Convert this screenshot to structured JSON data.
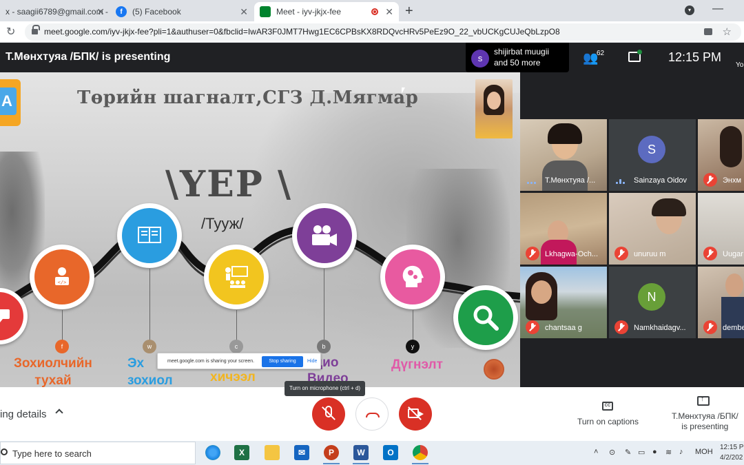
{
  "browser": {
    "tabs": [
      {
        "title": "x - saagii6789@gmail.com -",
        "favicon": "gmail-icon"
      },
      {
        "title": "(5) Facebook",
        "favicon": "facebook-icon"
      },
      {
        "title": "Meet - iyv-jkjx-fee",
        "favicon": "meet-icon",
        "active": true
      }
    ],
    "url": "meet.google.com/iyv-jkjx-fee?pli=1&authuser=0&fbclid=IwAR3F0JMT7Hwg1EC6CPBsKX8RDQvcHRv5PeEz9O_22_vbUCKgCUJeQbLzpO8"
  },
  "meet_header": {
    "presenting_title": "Т.Мөнхтуяа /БПК/ is presenting",
    "joined_avatar": "s",
    "joined_line1": "shijirbat muugii",
    "joined_line2": "and 50 more",
    "people_count": "62",
    "time": "12:15  PM",
    "you_label": "Yo"
  },
  "slide": {
    "title": "Төрийн шагналт,СГЗ Д.Мягмар",
    "heading": "\\ҮЕР \\",
    "subheading": "/Тууж/",
    "node_letters": [
      "f",
      "w",
      "c",
      "b",
      "y"
    ],
    "captions": [
      {
        "text": "Зохиолчийн\nтухай",
        "color": "#e8672a"
      },
      {
        "text": "Эх\nзохиол",
        "color": "#2a9de0"
      },
      {
        "text": "хичээл",
        "color": "#f2b51f"
      },
      {
        "text": "удио\nВидео",
        "color": "#7e3f98"
      },
      {
        "text": "Дүгнэлт",
        "color": "#e05aa8"
      }
    ],
    "colors": {
      "red": "#e43a3a",
      "orange": "#e8672a",
      "blue": "#2a9de0",
      "yellow": "#f2c51f",
      "purple": "#7e3f98",
      "pink": "#e85aa0",
      "green": "#1e9e4a"
    }
  },
  "share_notice": {
    "message": "meet.google.com is sharing your screen.",
    "stop_label": "Stop sharing",
    "hide_label": "Hide"
  },
  "participants": [
    {
      "name": "Т.Мөнхтуяа /...",
      "muted": false,
      "speaking": true
    },
    {
      "name": "Sainzaya Oidov",
      "muted": false,
      "speaking": true,
      "initial": "S",
      "initial_color": "#5c6bc0"
    },
    {
      "name": "Энхм",
      "muted": true
    },
    {
      "name": "Lkhagwa-Och...",
      "muted": true
    },
    {
      "name": "unuruu m",
      "muted": true
    },
    {
      "name": "Uugar",
      "muted": true
    },
    {
      "name": "chantsaa g",
      "muted": true
    },
    {
      "name": "Namkhaidagv...",
      "muted": true,
      "initial": "N",
      "initial_color": "#689f38"
    },
    {
      "name": "dembe",
      "muted": true
    }
  ],
  "callbar": {
    "meeting_details": "ing details",
    "tooltip": "Turn on microphone (ctrl + d)",
    "captions_label": "Turn on captions",
    "present_label_1": "Т.Мөнхтуяа /БПК/",
    "present_label_2": "is presenting"
  },
  "taskbar": {
    "search_placeholder": "Type here to search",
    "lang": "МОН",
    "time": "12:15 PM",
    "date": "4/2/202"
  }
}
